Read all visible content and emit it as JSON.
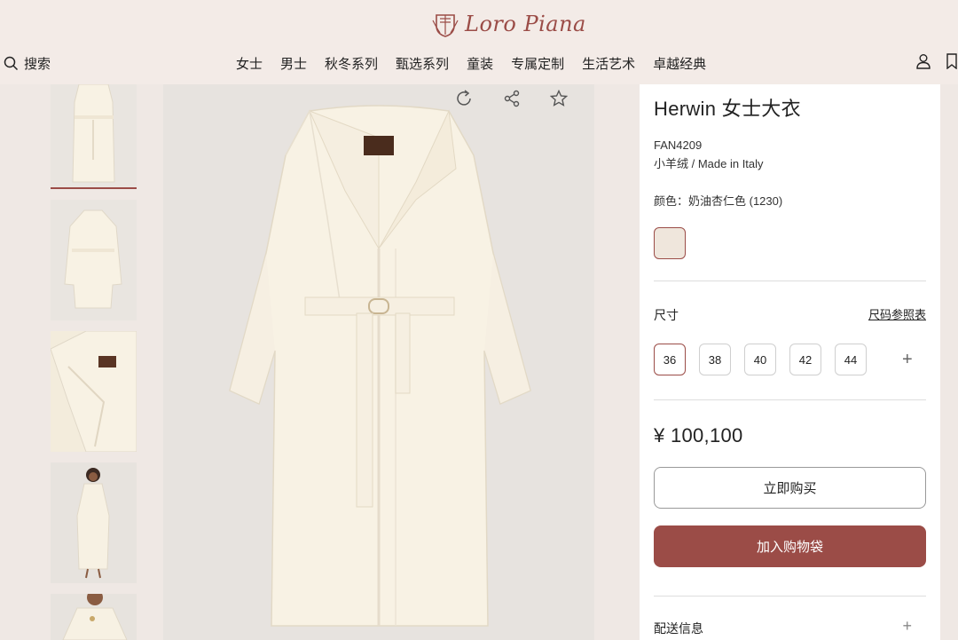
{
  "brand": {
    "name": "Loro Piana"
  },
  "header": {
    "search_label": "搜索",
    "nav": [
      "女士",
      "男士",
      "秋冬系列",
      "甄选系列",
      "童装",
      "专属定制",
      "生活艺术",
      "卓越经典"
    ]
  },
  "product": {
    "title": "Herwin 女士大衣",
    "sku": "FAN4209",
    "material": "小羊绒 / Made in Italy",
    "color_label": "颜色：",
    "color_value": "奶油杏仁色 (1230)",
    "swatch_color": "#efe6dc",
    "size_label": "尺寸",
    "size_guide": "尺码参照表",
    "sizes": [
      "36",
      "38",
      "40",
      "42",
      "44"
    ],
    "selected_size": "36",
    "price": "¥ 100,100",
    "buy_now": "立即购买",
    "add_to_bag": "加入购物袋",
    "delivery": "配送信息"
  },
  "colors": {
    "accent": "#9b4c47",
    "header_bg": "#f3ebe7",
    "image_bg": "#e7e3df"
  },
  "icons": [
    "search-icon",
    "account-icon",
    "bookmark-icon",
    "rotate-icon",
    "share-icon",
    "star-icon",
    "plus-icon"
  ]
}
